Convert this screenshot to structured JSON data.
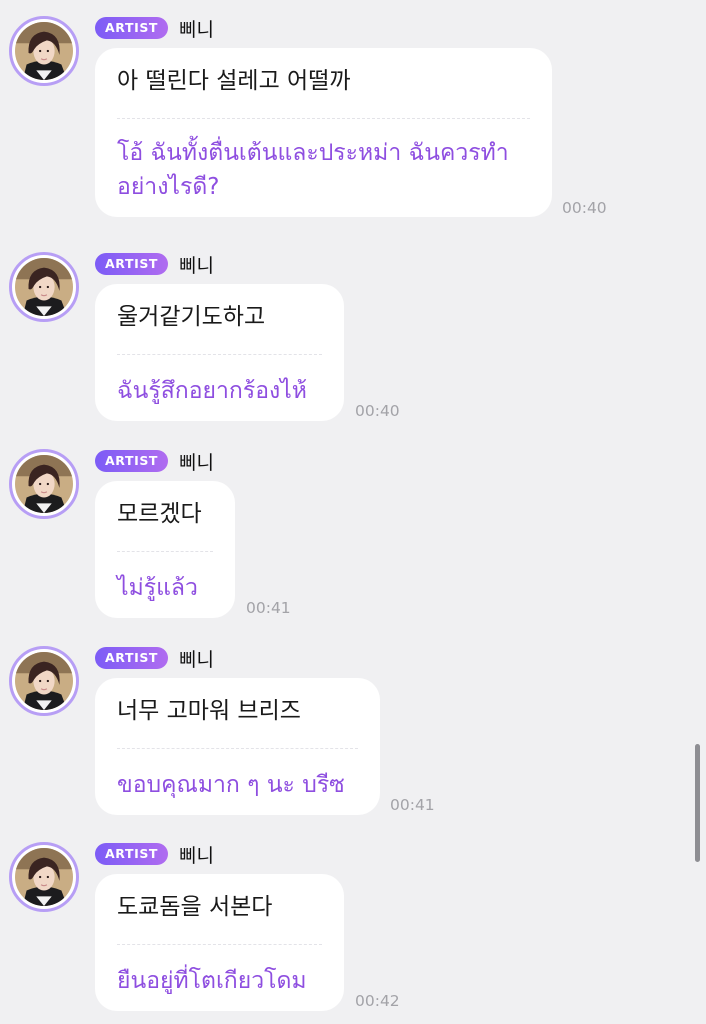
{
  "messages": [
    {
      "badge": "ARTIST",
      "sender": "삐니",
      "original": "아 떨린다 설레고 어떨까",
      "translation": "โอ้ ฉันทั้งตื่นเต้นและประหม่า ฉันควรทำอย่างไรดี?",
      "time": "00:40"
    },
    {
      "badge": "ARTIST",
      "sender": "삐니",
      "original": "울거같기도하고",
      "translation": "ฉันรู้สึกอยากร้องไห้",
      "time": "00:40"
    },
    {
      "badge": "ARTIST",
      "sender": "삐니",
      "original": "모르겠다",
      "translation": "ไม่รู้แล้ว",
      "time": "00:41"
    },
    {
      "badge": "ARTIST",
      "sender": "삐니",
      "original": "너무 고마워 브리즈",
      "translation": "ขอบคุณมาก ๆ นะ บรีซ",
      "time": "00:41"
    },
    {
      "badge": "ARTIST",
      "sender": "삐니",
      "original": "도쿄돔을 서본다",
      "translation": "ยืนอยู่ที่โตเกียวโดม",
      "time": "00:42"
    }
  ],
  "colors": {
    "background": "#f0f0f2",
    "translation_text": "#8e4ee0",
    "badge_start": "#7c5cf6",
    "badge_end": "#b06cf0",
    "avatar_ring": "#b79ef5"
  },
  "icons": {
    "avatar": "artist-profile-photo"
  }
}
